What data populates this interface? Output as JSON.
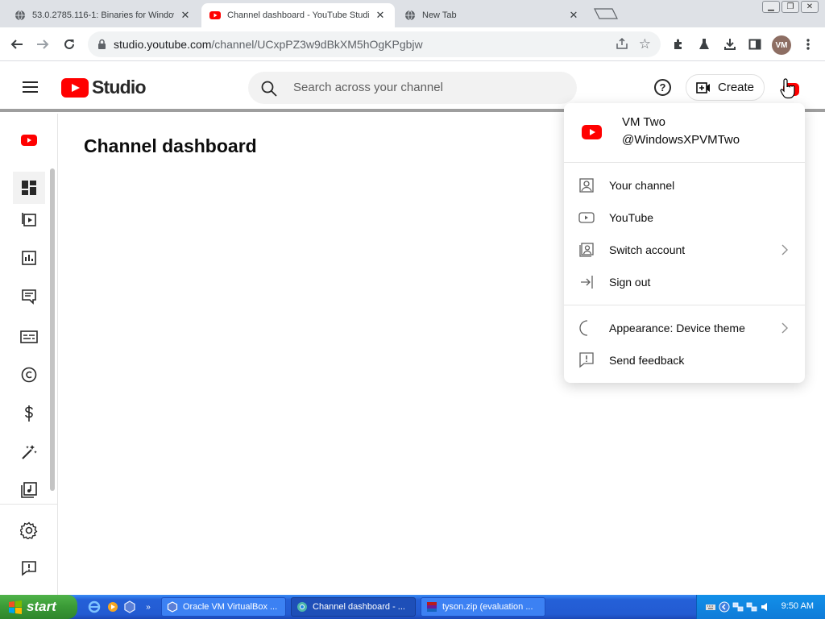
{
  "browser": {
    "tabs": [
      {
        "title": "53.0.2785.116-1: Binaries for Windows",
        "active": false
      },
      {
        "title": "Channel dashboard - YouTube Studio",
        "active": true
      },
      {
        "title": "New Tab",
        "active": false
      }
    ],
    "url_host": "studio.youtube.com",
    "url_path": "/channel/UCxpPZ3w9dBkXM5hOgKPgbjw",
    "profile_initials": "VM"
  },
  "studio": {
    "logo_text": "Studio",
    "search_placeholder": "Search across your channel",
    "create_label": "Create",
    "page_title": "Channel dashboard",
    "nav_items": [
      {
        "name": "channel-avatar-icon"
      },
      {
        "name": "dashboard-icon"
      },
      {
        "name": "content-icon"
      },
      {
        "name": "analytics-icon"
      },
      {
        "name": "comments-icon"
      },
      {
        "name": "subtitles-icon"
      },
      {
        "name": "copyright-icon"
      },
      {
        "name": "earn-icon"
      },
      {
        "name": "customization-icon"
      },
      {
        "name": "audio-library-icon"
      },
      {
        "name": "settings-icon"
      },
      {
        "name": "send-feedback-icon"
      }
    ]
  },
  "account_menu": {
    "name": "VM Two",
    "handle": "@WindowsXPVMTwo",
    "items": [
      {
        "label": "Your channel",
        "icon": "person-icon",
        "chevron": false
      },
      {
        "label": "YouTube",
        "icon": "youtube-icon",
        "chevron": false
      },
      {
        "label": "Switch account",
        "icon": "switch-account-icon",
        "chevron": true
      },
      {
        "label": "Sign out",
        "icon": "sign-out-icon",
        "chevron": false
      },
      {
        "label": "Appearance: Device theme",
        "icon": "moon-icon",
        "chevron": true
      },
      {
        "label": "Send feedback",
        "icon": "feedback-icon",
        "chevron": false
      }
    ]
  },
  "taskbar": {
    "start_label": "start",
    "tasks": [
      {
        "label": "Oracle VM VirtualBox ...",
        "active": false
      },
      {
        "label": "Channel dashboard - ...",
        "active": true
      },
      {
        "label": "tyson.zip (evaluation ...",
        "active": false
      }
    ],
    "clock": "9:50 AM"
  },
  "colors": {
    "youtube_red": "#ff0000",
    "xp_blue": "#235bd2",
    "xp_green": "#3a9a36"
  }
}
